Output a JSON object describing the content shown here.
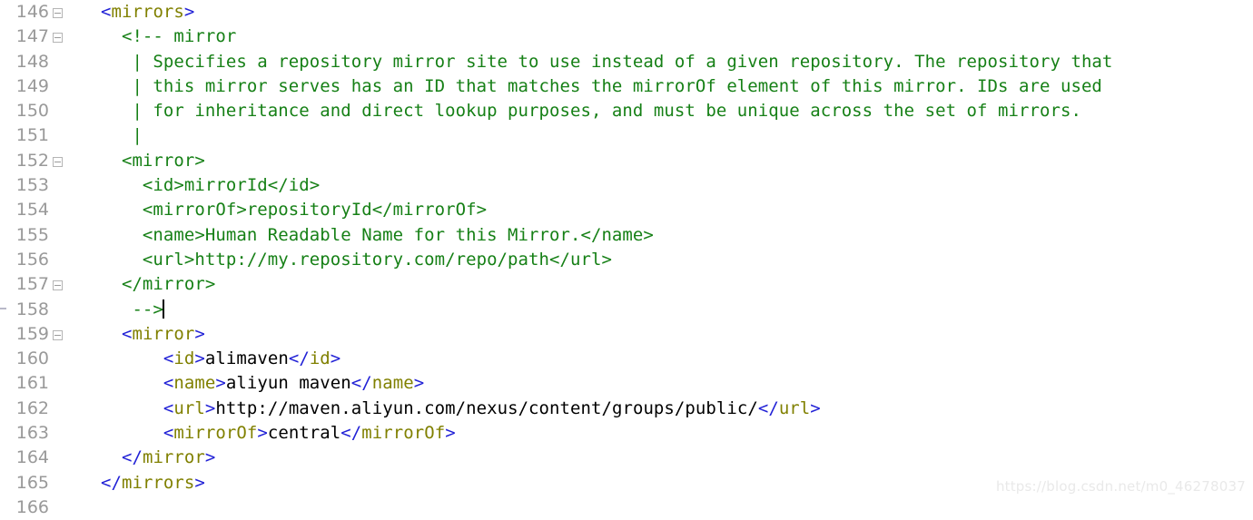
{
  "editor": {
    "language": "xml",
    "background_color": "#ffffff",
    "gutter_color": "#999999",
    "colors": {
      "comment": "#168016",
      "bracket": "#2121d6",
      "tag": "#808000",
      "text": "#000000",
      "caret": "#000000"
    },
    "first_line": 146,
    "last_line": 166
  },
  "lines": [
    {
      "number": "146",
      "fold": true,
      "changed": false,
      "tokens": [
        {
          "t": "text",
          "v": "  "
        },
        {
          "t": "bracket",
          "v": "<"
        },
        {
          "t": "tag",
          "v": "mirrors"
        },
        {
          "t": "bracket",
          "v": ">"
        }
      ]
    },
    {
      "number": "147",
      "fold": true,
      "changed": false,
      "tokens": [
        {
          "t": "comment",
          "v": "    <!-- mirror"
        }
      ]
    },
    {
      "number": "148",
      "fold": false,
      "changed": false,
      "tokens": [
        {
          "t": "comment",
          "v": "     | Specifies a repository mirror site to use instead of a given repository. The repository that"
        }
      ]
    },
    {
      "number": "149",
      "fold": false,
      "changed": false,
      "tokens": [
        {
          "t": "comment",
          "v": "     | this mirror serves has an ID that matches the mirrorOf element of this mirror. IDs are used"
        }
      ]
    },
    {
      "number": "150",
      "fold": false,
      "changed": false,
      "tokens": [
        {
          "t": "comment",
          "v": "     | for inheritance and direct lookup purposes, and must be unique across the set of mirrors."
        }
      ]
    },
    {
      "number": "151",
      "fold": false,
      "changed": false,
      "tokens": [
        {
          "t": "comment",
          "v": "     |"
        }
      ]
    },
    {
      "number": "152",
      "fold": true,
      "changed": false,
      "tokens": [
        {
          "t": "comment",
          "v": "    <mirror>"
        }
      ]
    },
    {
      "number": "153",
      "fold": false,
      "changed": false,
      "tokens": [
        {
          "t": "comment",
          "v": "      <id>mirrorId</id>"
        }
      ]
    },
    {
      "number": "154",
      "fold": false,
      "changed": false,
      "tokens": [
        {
          "t": "comment",
          "v": "      <mirrorOf>repositoryId</mirrorOf>"
        }
      ]
    },
    {
      "number": "155",
      "fold": false,
      "changed": false,
      "tokens": [
        {
          "t": "comment",
          "v": "      <name>Human Readable Name for this Mirror.</name>"
        }
      ]
    },
    {
      "number": "156",
      "fold": false,
      "changed": false,
      "tokens": [
        {
          "t": "comment",
          "v": "      <url>http://my.repository.com/repo/path</url>"
        }
      ]
    },
    {
      "number": "157",
      "fold": true,
      "changed": false,
      "tokens": [
        {
          "t": "comment",
          "v": "    </mirror>"
        }
      ]
    },
    {
      "number": "158",
      "fold": false,
      "changed": true,
      "caret": true,
      "tokens": [
        {
          "t": "comment",
          "v": "     -->"
        }
      ]
    },
    {
      "number": "159",
      "fold": true,
      "changed": false,
      "tokens": [
        {
          "t": "text",
          "v": "    "
        },
        {
          "t": "bracket",
          "v": "<"
        },
        {
          "t": "tag",
          "v": "mirror"
        },
        {
          "t": "bracket",
          "v": ">"
        }
      ]
    },
    {
      "number": "160",
      "fold": false,
      "changed": false,
      "tokens": [
        {
          "t": "text",
          "v": "        "
        },
        {
          "t": "bracket",
          "v": "<"
        },
        {
          "t": "tag",
          "v": "id"
        },
        {
          "t": "bracket",
          "v": ">"
        },
        {
          "t": "text",
          "v": "alimaven"
        },
        {
          "t": "bracket",
          "v": "</"
        },
        {
          "t": "tag",
          "v": "id"
        },
        {
          "t": "bracket",
          "v": ">"
        }
      ]
    },
    {
      "number": "161",
      "fold": false,
      "changed": false,
      "tokens": [
        {
          "t": "text",
          "v": "        "
        },
        {
          "t": "bracket",
          "v": "<"
        },
        {
          "t": "tag",
          "v": "name"
        },
        {
          "t": "bracket",
          "v": ">"
        },
        {
          "t": "text",
          "v": "aliyun maven"
        },
        {
          "t": "bracket",
          "v": "</"
        },
        {
          "t": "tag",
          "v": "name"
        },
        {
          "t": "bracket",
          "v": ">"
        }
      ]
    },
    {
      "number": "162",
      "fold": false,
      "changed": false,
      "tokens": [
        {
          "t": "text",
          "v": "        "
        },
        {
          "t": "bracket",
          "v": "<"
        },
        {
          "t": "tag",
          "v": "url"
        },
        {
          "t": "bracket",
          "v": ">"
        },
        {
          "t": "text",
          "v": "http://maven.aliyun.com/nexus/content/groups/public/"
        },
        {
          "t": "bracket",
          "v": "</"
        },
        {
          "t": "tag",
          "v": "url"
        },
        {
          "t": "bracket",
          "v": ">"
        }
      ]
    },
    {
      "number": "163",
      "fold": false,
      "changed": false,
      "tokens": [
        {
          "t": "text",
          "v": "        "
        },
        {
          "t": "bracket",
          "v": "<"
        },
        {
          "t": "tag",
          "v": "mirrorOf"
        },
        {
          "t": "bracket",
          "v": ">"
        },
        {
          "t": "text",
          "v": "central"
        },
        {
          "t": "bracket",
          "v": "</"
        },
        {
          "t": "tag",
          "v": "mirrorOf"
        },
        {
          "t": "bracket",
          "v": ">"
        }
      ]
    },
    {
      "number": "164",
      "fold": false,
      "changed": false,
      "tokens": [
        {
          "t": "text",
          "v": "    "
        },
        {
          "t": "bracket",
          "v": "</"
        },
        {
          "t": "tag",
          "v": "mirror"
        },
        {
          "t": "bracket",
          "v": ">"
        }
      ]
    },
    {
      "number": "165",
      "fold": false,
      "changed": false,
      "tokens": [
        {
          "t": "text",
          "v": "  "
        },
        {
          "t": "bracket",
          "v": "</"
        },
        {
          "t": "tag",
          "v": "mirrors"
        },
        {
          "t": "bracket",
          "v": ">"
        }
      ]
    },
    {
      "number": "166",
      "fold": false,
      "changed": false,
      "tokens": []
    }
  ],
  "watermark": {
    "text": "https://blog.csdn.net/m0_46278037"
  }
}
